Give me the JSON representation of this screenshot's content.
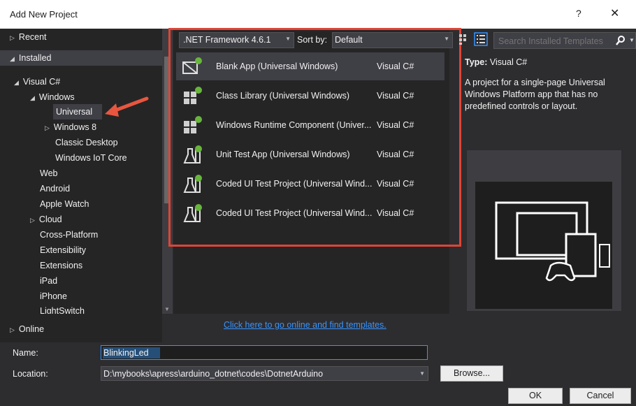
{
  "window": {
    "title": "Add New Project",
    "help": "?",
    "close": "✕"
  },
  "tree": {
    "recent": "Recent",
    "installed": "Installed",
    "visual_csharp": "Visual C#",
    "windows": "Windows",
    "universal": "Universal",
    "windows8": "Windows 8",
    "classic_desktop": "Classic Desktop",
    "windows_iot": "Windows IoT Core",
    "web": "Web",
    "android": "Android",
    "apple_watch": "Apple Watch",
    "cloud": "Cloud",
    "cross_platform": "Cross-Platform",
    "extensibility": "Extensibility",
    "extensions": "Extensions",
    "ipad": "iPad",
    "iphone": "iPhone",
    "lightswitch": "LightSwitch",
    "online": "Online"
  },
  "toolbar": {
    "framework": ".NET Framework 4.6.1",
    "sort_label": "Sort by:",
    "sort_value": "Default",
    "search_placeholder": "Search Installed Templates"
  },
  "templates": [
    {
      "name": "Blank App (Universal Windows)",
      "lang": "Visual C#"
    },
    {
      "name": "Class Library (Universal Windows)",
      "lang": "Visual C#"
    },
    {
      "name": "Windows Runtime Component (Univer...",
      "lang": "Visual C#"
    },
    {
      "name": "Unit Test App (Universal Windows)",
      "lang": "Visual C#"
    },
    {
      "name": "Coded UI Test Project (Universal Wind...",
      "lang": "Visual C#"
    },
    {
      "name": "Coded UI Test Project (Universal Wind...",
      "lang": "Visual C#"
    }
  ],
  "details": {
    "type_label": "Type:",
    "type_value": "Visual C#",
    "description": "A project for a single-page Universal Windows Platform app that has no predefined controls or layout."
  },
  "online_link": "Click here to go online and find templates.",
  "form": {
    "name_label": "Name:",
    "name_value": "BlinkingLed",
    "location_label": "Location:",
    "location_value": "D:\\mybooks\\apress\\arduino_dotnet\\codes\\DotnetArduino",
    "browse": "Browse...",
    "ok": "OK",
    "cancel": "Cancel"
  },
  "colors": {
    "accent": "#3794ff",
    "highlight_box": "#e04436",
    "arrow": "#e8563f"
  },
  "icons": [
    "close-icon",
    "help-icon",
    "arrow-pointer-icon",
    "search-icon",
    "list-view-icon",
    "small-icons-view-icon"
  ]
}
